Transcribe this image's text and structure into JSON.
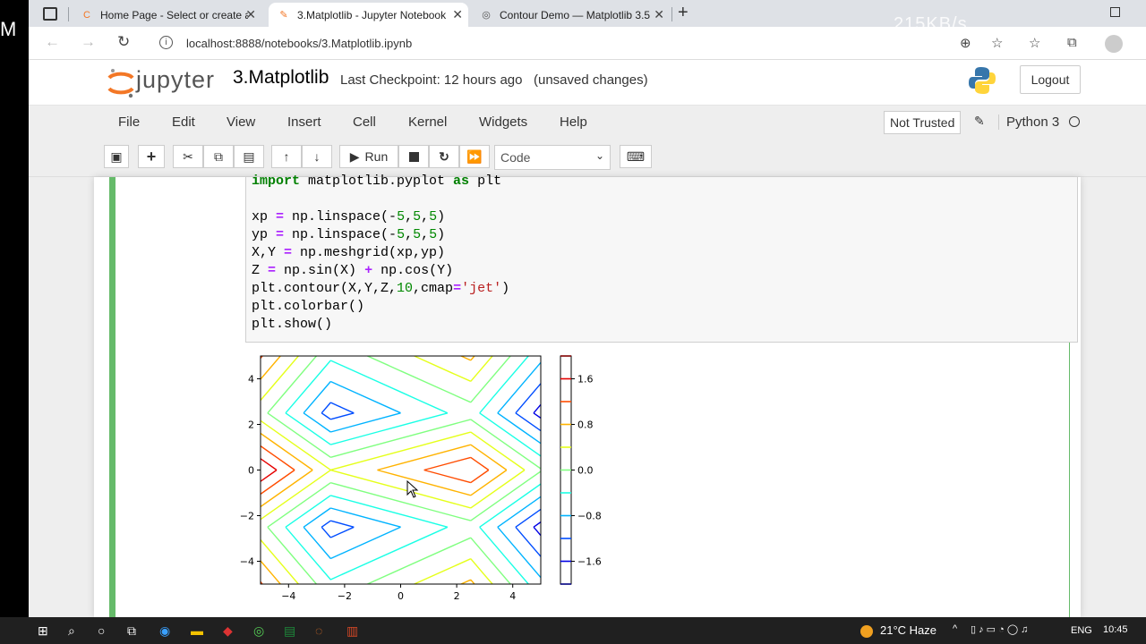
{
  "tabs": [
    {
      "title": "Home Page - Select or create a n",
      "active": false
    },
    {
      "title": "3.Matplotlib - Jupyter Notebook",
      "active": true
    },
    {
      "title": "Contour Demo — Matplotlib 3.5",
      "active": false
    }
  ],
  "taskbar_overlay_text": "215KB/s",
  "address": {
    "url": "localhost:8888/notebooks/3.Matplotlib.ipynb"
  },
  "jupyter": {
    "logo_text": "jupyter",
    "notebook_name": "3.Matplotlib",
    "checkpoint_label": "Last Checkpoint:",
    "checkpoint_time": "12 hours ago",
    "status": "(unsaved changes)",
    "logout_label": "Logout",
    "menu": [
      "File",
      "Edit",
      "View",
      "Insert",
      "Cell",
      "Kernel",
      "Widgets",
      "Help"
    ],
    "trust_label": "Not Trusted",
    "kernel_name": "Python 3",
    "run_label": "Run",
    "cell_type": "Code"
  },
  "code_lines": [
    "import matplotlib.pyplot as plt",
    "",
    "xp = np.linspace(-5,5,5)",
    "yp = np.linspace(-5,5,5)",
    "X,Y = np.meshgrid(xp,yp)",
    "Z = np.sin(X) + np.cos(Y)",
    "plt.contour(X,Y,Z,10,cmap='jet')",
    "plt.colorbar()",
    "plt.show()"
  ],
  "chart_data": {
    "type": "contour",
    "x_ticks": [
      "−4",
      "−2",
      "0",
      "2",
      "4"
    ],
    "y_ticks": [
      "−4",
      "−2",
      "0",
      "2",
      "4"
    ],
    "xlim": [
      -5,
      5
    ],
    "ylim": [
      -5,
      5
    ],
    "levels": 10,
    "colormap": "jet",
    "colorbar_ticks": [
      "−1.6",
      "−0.8",
      "0.0",
      "0.8",
      "1.6"
    ],
    "colorbar_range": [
      -2,
      2
    ],
    "grid": false,
    "xp": [
      -5,
      -2.5,
      0,
      2.5,
      5
    ],
    "yp": [
      -5,
      -2.5,
      0,
      2.5,
      5
    ]
  },
  "taskbar": {
    "weather": "21°C  Haze",
    "language": "ENG",
    "time": "10:45"
  }
}
